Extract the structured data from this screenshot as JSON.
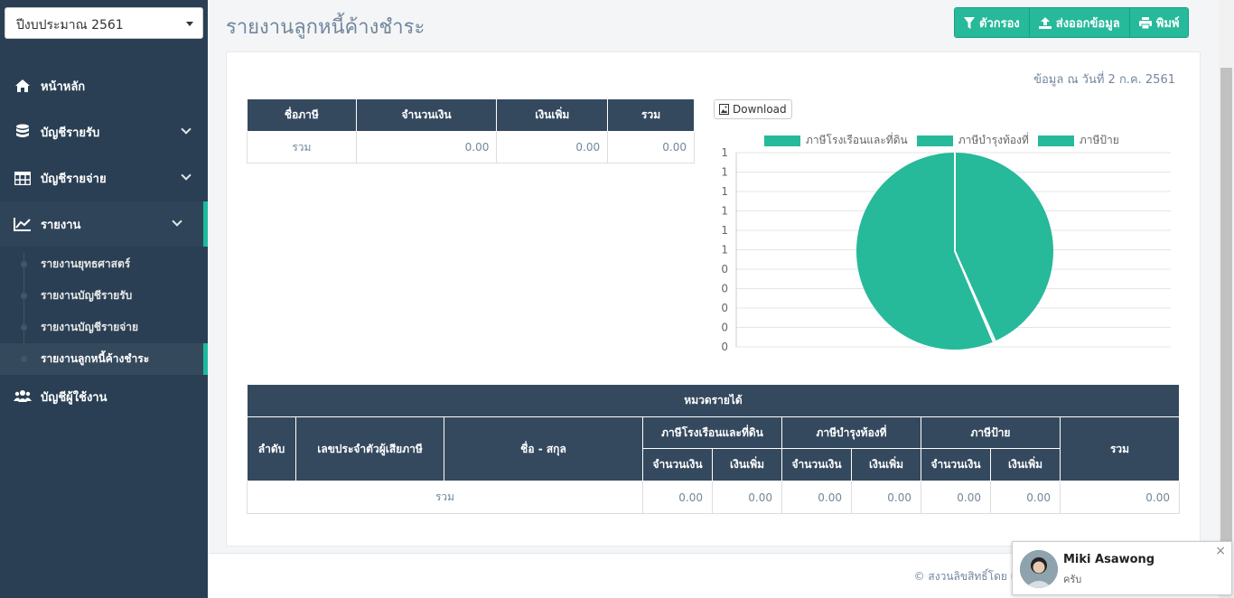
{
  "sidebar": {
    "year_select": "ปีงบประมาณ 2561",
    "items": [
      {
        "label": "หน้าหลัก"
      },
      {
        "label": "บัญชีรายรับ"
      },
      {
        "label": "บัญชีรายจ่าย"
      },
      {
        "label": "รายงาน"
      },
      {
        "label": "บัญชีผู้ใช้งาน"
      }
    ],
    "sub_items": [
      {
        "label": "รายงานยุทธศาสตร์"
      },
      {
        "label": "รายงานบัญชีรายรับ"
      },
      {
        "label": "รายงานบัญชีรายจ่าย"
      },
      {
        "label": "รายงานลูกหนี้ค้างชำระ"
      }
    ]
  },
  "header": {
    "title": "รายงานลูกหนี้ค้างชำระ",
    "filter_label": "ตัวกรอง",
    "export_label": "ส่งออกข้อมูล",
    "print_label": "พิมพ์"
  },
  "panel": {
    "data_date": "ข้อมูล ณ วันที่ 2 ก.ค. 2561",
    "download_label": "Download"
  },
  "summary_table": {
    "headers": [
      "ชื่อภาษี",
      "จำนวนเงิน",
      "เงินเพิ่ม",
      "รวม"
    ],
    "row": [
      "รวม",
      "0.00",
      "0.00",
      "0.00"
    ]
  },
  "chart_data": {
    "type": "pie",
    "legend": [
      "ภาษีโรงเรือนและที่ดิน",
      "ภาษีบำรุงท้องที่",
      "ภาษีป้าย"
    ],
    "values": [
      0,
      0,
      0
    ],
    "y_tick_labels": [
      "1",
      "1",
      "1",
      "1",
      "1",
      "1",
      "0",
      "0",
      "0",
      "0",
      "0"
    ],
    "legend_placement": "top",
    "grid": true,
    "color": "#26b99a"
  },
  "detail_table": {
    "group_header": "หมวดรายได้",
    "col_no": "ลำดับ",
    "col_taxid": "เลขประจำตัวผู้เสียภาษี",
    "col_name": "ชื่อ - สกุล",
    "tax_groups": [
      "ภาษีโรงเรือนและที่ดิน",
      "ภาษีบำรุงท้องที่",
      "ภาษีป้าย"
    ],
    "sub_amount": "จำนวนเงิน",
    "sub_extra": "เงินเพิ่ม",
    "col_total": "รวม",
    "total_row": {
      "label": "รวม",
      "values": [
        "0.00",
        "0.00",
        "0.00",
        "0.00",
        "0.00",
        "0.00",
        "0.00"
      ]
    }
  },
  "footer": {
    "text": "© สงวนลิขสิทธิ์โดย เทศบาลตำบลหนองป่าครั่ง พัฒนาโดย บริษ"
  },
  "chat": {
    "name": "Miki Asawong",
    "message": "ครับ",
    "close": "×"
  },
  "colors": {
    "sidebar_bg": "#2a3f54",
    "accent": "#26b99a",
    "table_header": "#34495e"
  }
}
